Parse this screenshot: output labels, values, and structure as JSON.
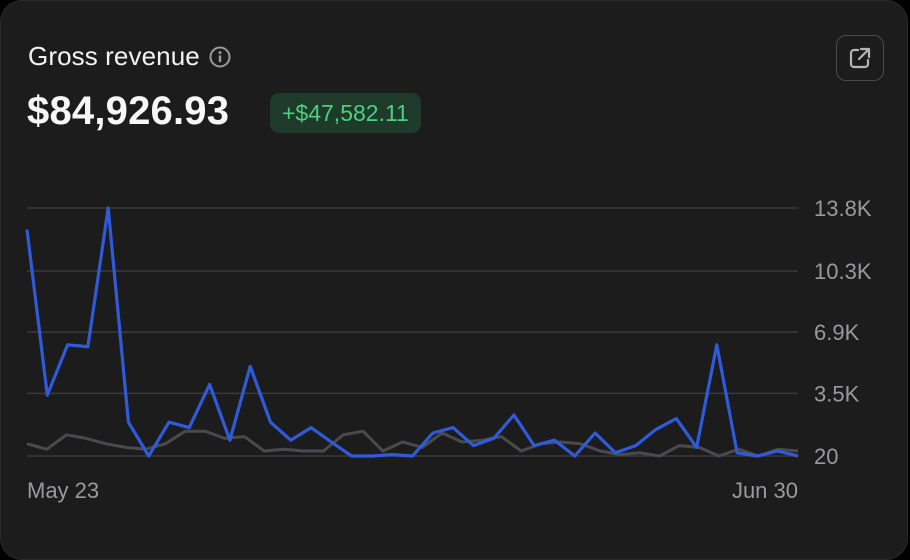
{
  "card": {
    "title": "Gross revenue",
    "total": "$84,926.93",
    "delta": "+$47,582.11"
  },
  "icons": {
    "info": "info-icon",
    "open": "external-link-icon"
  },
  "colors": {
    "current": "#2f5bdb",
    "previous": "#4a4a4c",
    "delta_bg": "#1e3a2a",
    "delta_text": "#4cd07d"
  },
  "chart_data": {
    "type": "line",
    "title": "Gross revenue",
    "x_start_label": "May 23",
    "x_end_label": "Jun 30",
    "y_ticks": [
      "13.8K",
      "10.3K",
      "6.9K",
      "3.5K",
      "20"
    ],
    "y_tick_values": [
      13800,
      10300,
      6900,
      3500,
      20
    ],
    "ylim": [
      20,
      13800
    ],
    "grid": true,
    "series": [
      {
        "values": [
          12600,
          3400,
          6200,
          6100,
          13800,
          1900,
          20,
          1900,
          1600,
          4000,
          900,
          5000,
          1900,
          900,
          1600,
          800,
          20,
          20,
          100,
          20,
          1300,
          1600,
          600,
          1000,
          2300,
          600,
          900,
          20,
          1300,
          200,
          600,
          1500,
          2100,
          500,
          6200,
          200,
          20,
          300,
          20
        ]
      },
      {
        "values": [
          700,
          400,
          1200,
          1000,
          700,
          500,
          400,
          700,
          1400,
          1400,
          1000,
          1100,
          300,
          400,
          300,
          300,
          1200,
          1400,
          300,
          800,
          500,
          1300,
          800,
          900,
          1100,
          300,
          700,
          800,
          700,
          300,
          100,
          200,
          20,
          600,
          500,
          20,
          400,
          20,
          400,
          300
        ]
      }
    ]
  }
}
